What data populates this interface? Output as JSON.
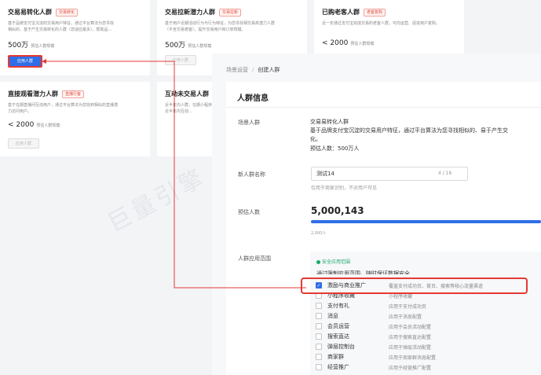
{
  "cards": [
    {
      "title": "交易易转化人群",
      "tag": "交易转化",
      "desc": [
        "基于品牌支付宝沉淀的交易用户特征，通过平台算法为您寻找",
        "相似的、基于产生交易转化的人群（您适应最多），帮助品..."
      ],
      "count": "500万",
      "count_label": "预估人群规模",
      "button": "应用人群",
      "button_state": "primary"
    },
    {
      "title": "交易拉新潜力人群",
      "tag": "交易拉新",
      "desc": [
        "基于用户近期活动行为与行为特征，为您寻找相交易高潜力人群",
        "（不含交易老客），提升交易用户和订单规模。"
      ],
      "count": "500万",
      "count_label": "预估人群规模",
      "button": "应用人群",
      "button_state": "disabled"
    },
    {
      "title": "已购老客人群",
      "tag": "老客复购",
      "desc": [
        "近一年通过支付宝完成交易的老客人群，可向运营、促进用户复购。",
        ""
      ],
      "count": "< 2000",
      "count_label": "预估人群规模",
      "button": "",
      "button_state": "none"
    },
    {
      "title": "直接观看潜力人群",
      "tag": "直播行客",
      "desc": [
        "基于在期直播间互动用户，通过平台算法为您找到相似的直播潜",
        "力访问用户。"
      ],
      "count": "< 2000",
      "count_label": "预估人群规模",
      "button": "应用人群",
      "button_state": "disabled"
    },
    {
      "title": "互动未交易人群",
      "tag": "",
      "desc": [
        "近半年内人群，在期小程序",
        "近半年内互动..."
      ],
      "count": "",
      "count_label": "",
      "button": "",
      "button_state": "none"
    }
  ],
  "watermark": "巨量引擎",
  "panel": {
    "breadcrumb": [
      "场景运营",
      "/",
      "创建人群"
    ],
    "section_title": "人群信息",
    "scene_label": "场景人群",
    "scene_name": "交易易转化人群",
    "scene_desc": [
      "基于品牌支付宝沉淀的交易用户特征，通过平台算法为您寻找相似的、易于产生交",
      "化。"
    ],
    "scene_estimate": "预估人数：500万人",
    "name_label": "新人群名称",
    "name_value": "测试14",
    "name_count": "4 / 16",
    "name_hint": "仅用于商家识别，不对用户可见",
    "estimate_label": "预估人数",
    "estimate_value": "5,000,143",
    "progress": 1.0,
    "progress_label": "2,000人",
    "scope_label": "人群应用范围",
    "safe_title": "安全应用范围",
    "safe_desc": "通过限制应用范围，随时保证数据安全",
    "options": [
      {
        "name": "激励与商业推广",
        "desc": "覆盖支付成功页、首页、搜索等核心流量渠道",
        "checked": true
      },
      {
        "name": "小程序收藏",
        "desc": "小程序收藏",
        "checked": false
      },
      {
        "name": "支付有礼",
        "desc": "应用于支付成功页",
        "checked": false
      },
      {
        "name": "消息",
        "desc": "应用于消息配置",
        "checked": false
      },
      {
        "name": "会员运营",
        "desc": "应用于会员活动配置",
        "checked": false
      },
      {
        "name": "搜索直达",
        "desc": "应用于搜索直达配置",
        "checked": false
      },
      {
        "name": "弹层控制台",
        "desc": "应用于弹层活动配置",
        "checked": false
      },
      {
        "name": "商家群",
        "desc": "应用于商家群消息配置",
        "checked": false
      },
      {
        "name": "经营推广",
        "desc": "应用于经营推广配置",
        "checked": false
      }
    ]
  },
  "colors": {
    "primary": "#2f6ee6",
    "annotation": "#e53935",
    "safe": "#1aa86b"
  }
}
